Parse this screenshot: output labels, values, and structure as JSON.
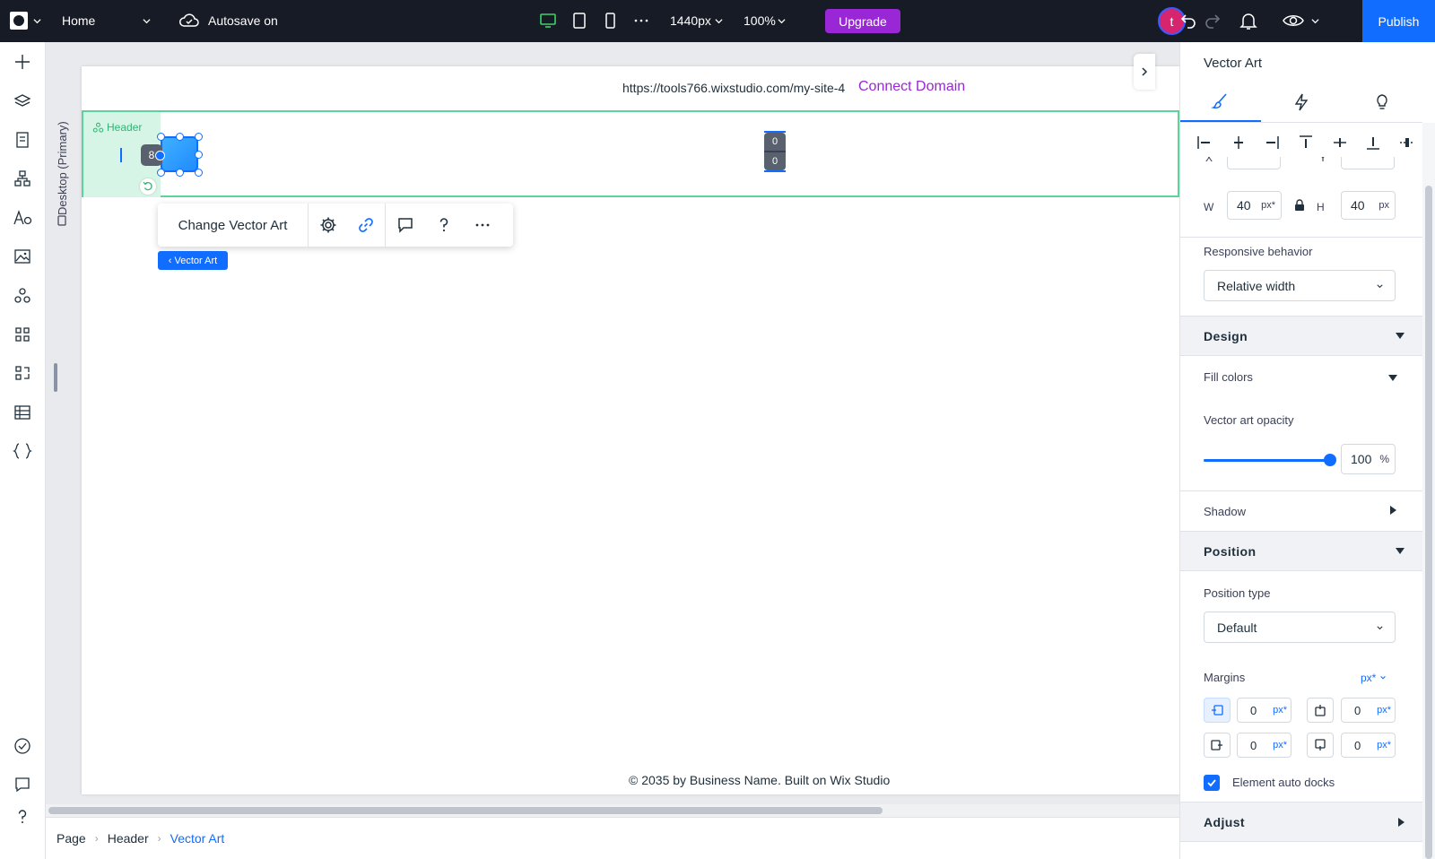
{
  "topbar": {
    "page_name": "Home",
    "autosave_label": "Autosave on",
    "width_value": "1440px",
    "zoom_value": "100%",
    "upgrade_label": "Upgrade",
    "avatar_initial": "t",
    "publish_label": "Publish",
    "colors": {
      "background": "#161b26",
      "upgrade": "#9a27d5",
      "publish": "#116dff",
      "desktop_active": "#3fd16a"
    }
  },
  "canvas": {
    "viewport_label": "Desktop (Primary)",
    "url": "https://tools766.wixstudio.com/my-site-4",
    "connect_domain": "Connect Domain",
    "header_tag": "Header",
    "selection_badge": "8",
    "spacer_top": "0",
    "spacer_bottom": "0",
    "footer_text": "© 2035 by Business Name. Built on Wix Studio"
  },
  "floating_toolbar": {
    "change_label": "Change Vector Art",
    "icons": [
      "settings-icon",
      "link-icon",
      "comment-icon",
      "help-icon",
      "more-icon"
    ]
  },
  "element_tag": "‹ Vector Art",
  "breadcrumbs": [
    {
      "label": "Page"
    },
    {
      "label": "Header"
    },
    {
      "label": "Vector Art"
    }
  ],
  "panel": {
    "title": "Vector Art",
    "tabs": [
      "design-tab-brush-icon",
      "interactions-tab-bolt-icon",
      "tips-tab-bulb-icon"
    ],
    "partial_x_label": "X",
    "partial_y_label": "Y",
    "w_label": "W",
    "w_value": "40",
    "w_unit": "px*",
    "h_label": "H",
    "h_value": "40",
    "h_unit": "px",
    "responsive_label": "Responsive behavior",
    "responsive_value": "Relative width",
    "design_header": "Design",
    "fill_colors_label": "Fill colors",
    "opacity_label": "Vector art opacity",
    "opacity_value": "100",
    "opacity_unit": "%",
    "opacity_fraction": 1.0,
    "shadow_label": "Shadow",
    "position_header": "Position",
    "position_type_label": "Position type",
    "position_type_value": "Default",
    "margins_label": "Margins",
    "margins_unit": "px*",
    "margins": {
      "left": "0",
      "top": "0",
      "right": "0",
      "bottom": "0",
      "unit": "px*"
    },
    "auto_docks_label": "Element auto docks",
    "auto_docks_checked": true,
    "adjust_header": "Adjust"
  }
}
